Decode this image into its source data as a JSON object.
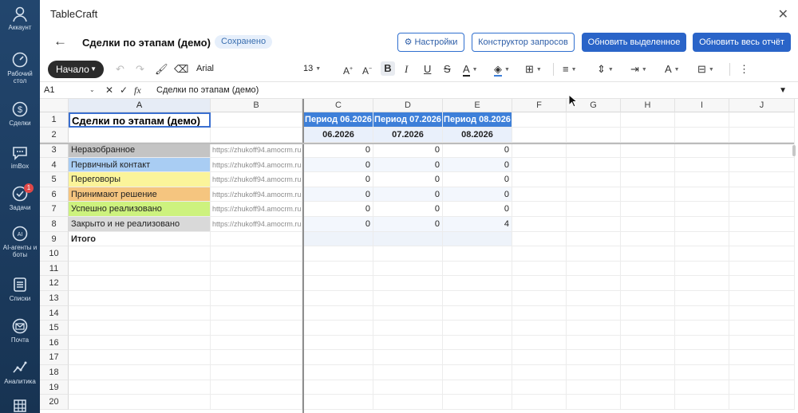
{
  "nav": {
    "items": [
      {
        "label": "Аккаунт"
      },
      {
        "label": "Рабочий стол"
      },
      {
        "label": "Сделки"
      },
      {
        "label": "imBox"
      },
      {
        "label": "Задачи",
        "badge": "1"
      },
      {
        "label": "AI-агенты и боты"
      },
      {
        "label": "Списки"
      },
      {
        "label": "Почта"
      },
      {
        "label": "Аналитика"
      }
    ]
  },
  "app": {
    "title": "TableCraft"
  },
  "doc": {
    "title": "Сделки по этапам (демо)",
    "status": "Сохранено",
    "settings_btn": "⚙ Настройки",
    "query_btn": "Конструктор запросов",
    "refresh_sel_btn": "Обновить выделенное",
    "refresh_all_btn": "Обновить весь отчёт"
  },
  "toolbar": {
    "start": "Начало",
    "font": "Arial",
    "size": "13"
  },
  "formula": {
    "cell_ref": "A1",
    "fx": "fx",
    "value": "Сделки по этапам (демо)"
  },
  "grid": {
    "columns": [
      "A",
      "B",
      "C",
      "D",
      "E",
      "F",
      "G",
      "H",
      "I",
      "J"
    ],
    "rows": [
      "1",
      "2",
      "3",
      "4",
      "5",
      "6",
      "7",
      "8",
      "9",
      "10",
      "11",
      "12",
      "13",
      "14",
      "15",
      "16",
      "17",
      "18",
      "19",
      "20"
    ],
    "title_cell": "Сделки по этапам (демо)",
    "period_headers": [
      "Период 06.2026",
      "Период 07.2026",
      "Период 08.2026"
    ],
    "period_sub": [
      "06.2026",
      "07.2026",
      "08.2026"
    ],
    "stages": [
      {
        "name": "Неразобранное",
        "color": "#c4c4c4",
        "url": "https://zhukoff94.amocrm.ru",
        "values": [
          "0",
          "0",
          "0"
        ]
      },
      {
        "name": "Первичный контакт",
        "color": "#a9cdf3",
        "url": "https://zhukoff94.amocrm.ru",
        "values": [
          "0",
          "0",
          "0"
        ]
      },
      {
        "name": "Переговоры",
        "color": "#fbf49a",
        "url": "https://zhukoff94.amocrm.ru",
        "values": [
          "0",
          "0",
          "0"
        ]
      },
      {
        "name": "Принимают решение",
        "color": "#f5c57f",
        "url": "https://zhukoff94.amocrm.ru",
        "values": [
          "0",
          "0",
          "0"
        ]
      },
      {
        "name": "Успешно реализовано",
        "color": "#cdf27e",
        "url": "https://zhukoff94.amocrm.ru",
        "values": [
          "0",
          "0",
          "0"
        ]
      },
      {
        "name": "Закрыто и не реализовано",
        "color": "#d9d9d9",
        "url": "https://zhukoff94.amocrm.ru",
        "values": [
          "0",
          "0",
          "4"
        ]
      }
    ],
    "total_label": "Итого"
  }
}
